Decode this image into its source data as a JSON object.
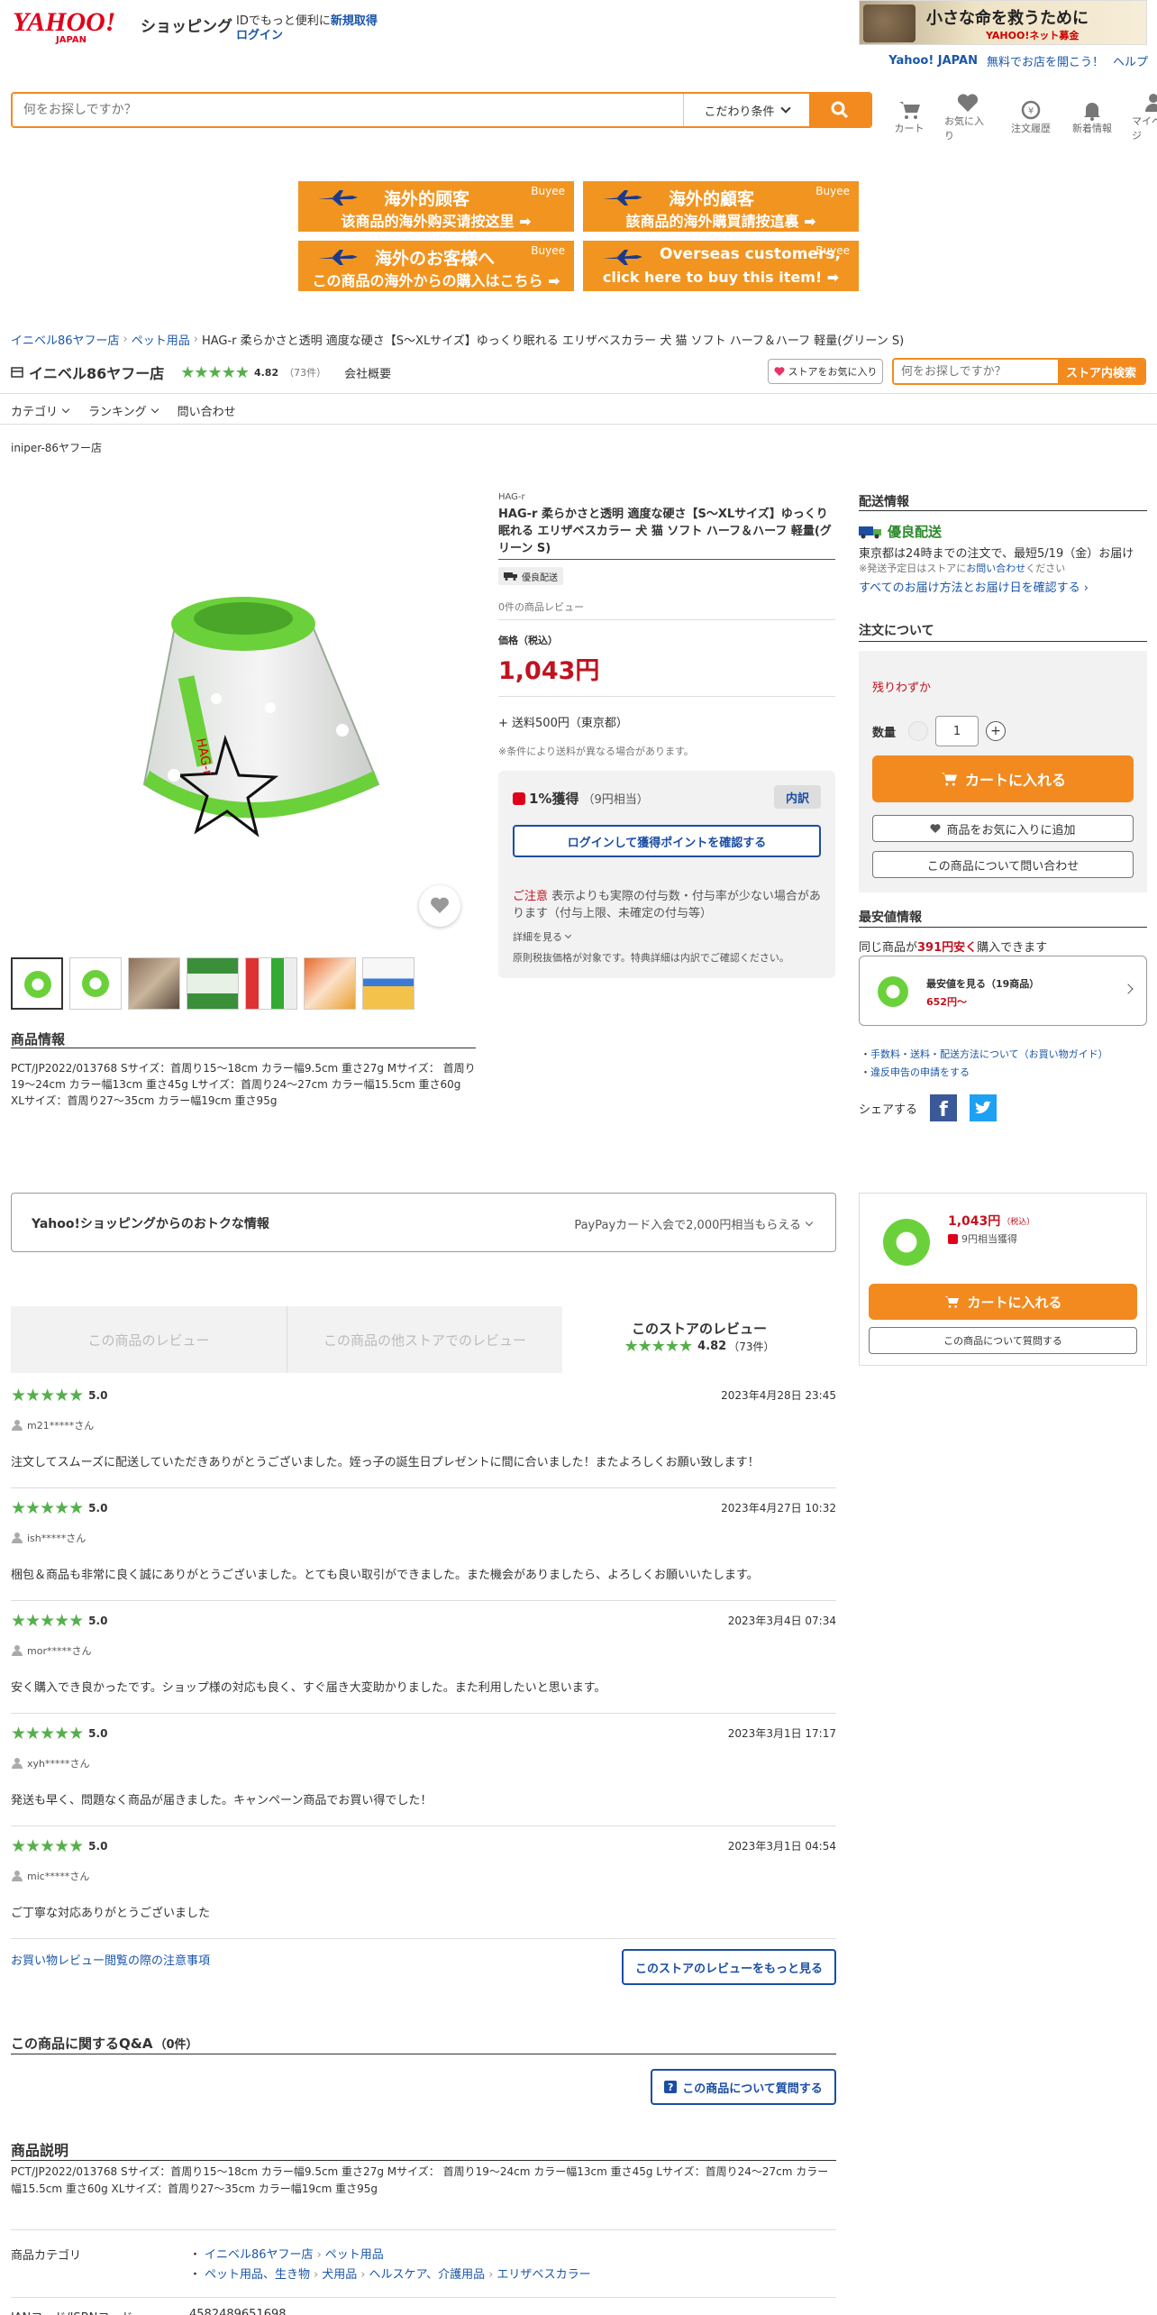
{
  "header": {
    "logo_top": "YAHOO!",
    "logo_bottom": "JAPAN",
    "shopping": "ショッピング",
    "id_text": "IDでもっと便利に",
    "register": "新規取得",
    "login": "ログイン",
    "ad_text": "小さな命を救うために",
    "ad_sub": "YAHOO!ネット募金",
    "links": [
      "Yahoo! JAPAN",
      "無料でお店を開こう！",
      "ヘルプ"
    ],
    "search_placeholder": "何をお探しですか？",
    "conditions": "こだわり条件",
    "icons": [
      "カート",
      "お気に入り",
      "注文履歴",
      "新着情報",
      "マイページ"
    ]
  },
  "banners": [
    {
      "t1": "海外的顾客",
      "t2": "该商品的海外购买请按这里 ➡"
    },
    {
      "t1": "海外的顧客",
      "t2": "該商品的海外購買請按這裏 ➡"
    },
    {
      "t1": "海外のお客様へ",
      "t2": "この商品の海外からの購入はこちら ➡"
    },
    {
      "t1": "Overseas customers,",
      "t2": "click here to buy this item! ➡"
    }
  ],
  "buyee": "Buyee",
  "breadcrumb": [
    "イニベル86ヤフー店",
    "ペット用品",
    "HAG-r 柔らかさと透明 適度な硬さ【S〜XLサイズ】ゆっくり眠れる エリザベスカラー 犬 猫 ソフト ハーフ＆ハーフ 軽量(グリーン S)"
  ],
  "store": {
    "name": "イニベル86ヤフー店",
    "rating": "4.82",
    "count": "（73件）",
    "overview": "会社概要",
    "fav": "ストアをお気に入り",
    "search_placeholder": "何をお探しですか？",
    "search_btn": "ストア内検索",
    "nav": [
      "カテゴリ",
      "ランキング",
      "問い合わせ"
    ],
    "label": "iniper-86ヤフー店"
  },
  "product": {
    "brand": "HAG-r",
    "title": "HAG-r 柔らかさと透明 適度な硬さ【S〜XLサイズ】ゆっくり眠れる エリザベスカラー 犬 猫 ソフト ハーフ＆ハーフ 軽量(グリーン S)",
    "badge": "優良配送",
    "reviews": "0件の商品レビュー",
    "price_label": "価格（税込）",
    "price": "1,043円",
    "shipping": "+ 送料500円（東京都）",
    "shipping_note": "※条件により送料が異なる場合があります。",
    "points": "1%獲得",
    "points_sub": "（9円相当）",
    "breakdown": "内訳",
    "login_points": "ログインして獲得ポイントを確認する",
    "caution_label": "ご注意",
    "caution": "表示よりも実際の付与数・付与率が少ない場合があります（付与上限、未確定の付与等）",
    "details": "詳細を見る",
    "tax_note": "原則税抜価格が対象です。特典詳細は内訳でご確認ください。",
    "info_title": "商品情報",
    "info": "PCT/JP2022/013768 Sサイズ：首周り15〜18cm カラー幅9.5cm 重さ27g Mサイズ： 首周り19〜24cm カラー幅13cm 重さ45g Lサイズ：首周り24〜27cm カラー幅15.5cm 重さ60g XLサイズ：首周り27〜35cm カラー幅19cm 重さ95g"
  },
  "delivery": {
    "title": "配送情報",
    "badge": "優良配送",
    "text": "東京都は24時までの注文で、最短5/19（金）お届け",
    "note_prefix": "※発送予定日はストアに",
    "note_link": "お問い合わせ",
    "note_suffix": "ください",
    "link": "すべてのお届け方法とお届け日を確認する"
  },
  "order": {
    "title": "注文について",
    "stock": "残りわずか",
    "qty_label": "数量",
    "qty": "1",
    "cart": "カートに入れる",
    "fav": "商品をお気に入りに追加",
    "ask": "この商品について問い合わせ"
  },
  "lowest": {
    "title": "最安値情報",
    "text_prefix": "同じ商品が",
    "amount": "391円安く",
    "text_suffix": "購入できます",
    "card_title": "最安値を見る（19商品）",
    "card_price": "652円〜",
    "links": [
      "手数料・送料・配送方法について（お買い物ガイド）",
      "違反申告の申請をする"
    ],
    "share": "シェアする"
  },
  "deals": {
    "title": "Yahoo!ショッピングからのおトクな情報",
    "right": "PayPayカード入会で2,000円相当もらえる"
  },
  "sticky": {
    "price": "1,043円",
    "tax": "（税込）",
    "points": "9円相当獲得",
    "cart": "カートに入れる",
    "ask": "この商品について質問する"
  },
  "review_tabs": [
    "この商品のレビュー",
    "この商品の他ストアでのレビュー",
    "このストアのレビュー"
  ],
  "review_tab_rating": "4.82",
  "review_tab_count": "（73件）",
  "reviews": [
    {
      "score": "5.0",
      "date": "2023年4月28日 23:45",
      "user": "m21*****さん",
      "text": "注文してスムーズに配送していただきありがとうございました。姪っ子の誕生日プレゼントに間に合いました！またよろしくお願い致します！"
    },
    {
      "score": "5.0",
      "date": "2023年4月27日 10:32",
      "user": "ish*****さん",
      "text": "梱包＆商品も非常に良く誠にありがとうございました。とても良い取引ができました。また機会がありましたら、よろしくお願いいたします。"
    },
    {
      "score": "5.0",
      "date": "2023年3月4日 07:34",
      "user": "mor*****さん",
      "text": "安く購入でき良かったです。ショップ様の対応も良く、すぐ届き大変助かりました。また利用したいと思います。"
    },
    {
      "score": "5.0",
      "date": "2023年3月1日 17:17",
      "user": "xyh*****さん",
      "text": "発送も早く、問題なく商品が届きました。キャンペーン商品でお買い得でした！"
    },
    {
      "score": "5.0",
      "date": "2023年3月1日 04:54",
      "user": "mic*****さん",
      "text": "ご丁寧な対応ありがとうございました"
    }
  ],
  "review_note": "お買い物レビュー閲覧の際の注意事項",
  "review_more": "このストアのレビューをもっと見る",
  "qa": {
    "title": "この商品に関するQ&A",
    "count": "（0件）",
    "btn": "この商品について質問する"
  },
  "description": {
    "title": "商品説明",
    "text": "PCT/JP2022/013768 Sサイズ：首周り15〜18cm カラー幅9.5cm 重さ27g Mサイズ： 首周り19〜24cm カラー幅13cm 重さ45g Lサイズ：首周り24〜27cm カラー幅15.5cm 重さ60g XLサイズ：首周り27〜35cm カラー幅19cm 重さ95g",
    "cat_label": "商品カテゴリ",
    "cat1": [
      "イニベル86ヤフー店",
      "ペット用品"
    ],
    "cat2": [
      "ペット用品、生き物",
      "犬用品",
      "ヘルスケア、介護用品",
      "エリザベスカラー"
    ],
    "jan_label": "JANコード/ISBNコード",
    "jan": "4582489651698"
  },
  "colors": {
    "accent": "#f28a1f",
    "price": "#c1121f",
    "link": "#1a56a8",
    "star": "#55b04b"
  }
}
